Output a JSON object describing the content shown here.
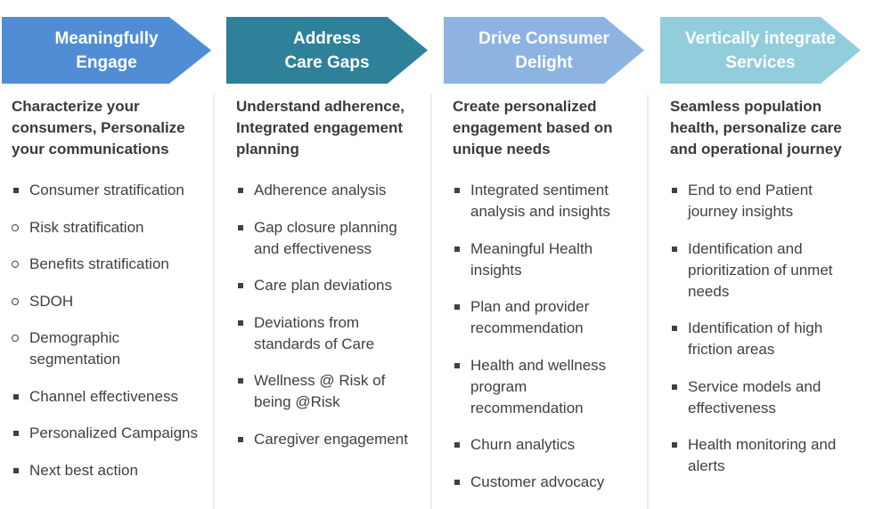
{
  "stages": [
    {
      "title_lines": [
        "Meaningfully",
        "Engage"
      ],
      "color": "#518dd4",
      "heading": "Characterize your consumers, Personalize your communications",
      "items": [
        {
          "text": "Consumer stratification",
          "bullet": "square"
        },
        {
          "text": "Risk stratification",
          "bullet": "circle"
        },
        {
          "text": "Benefits stratification",
          "bullet": "circle"
        },
        {
          "text": "SDOH",
          "bullet": "circle"
        },
        {
          "text": "Demographic segmentation",
          "bullet": "circle"
        },
        {
          "text": "Channel effectiveness",
          "bullet": "square"
        },
        {
          "text": "Personalized Campaigns",
          "bullet": "square"
        },
        {
          "text": "Next best action",
          "bullet": "square"
        }
      ]
    },
    {
      "title_lines": [
        "Address",
        "Care Gaps"
      ],
      "color": "#2f8199",
      "heading": "Understand adherence, Integrated engagement planning",
      "items": [
        {
          "text": "Adherence analysis",
          "bullet": "square"
        },
        {
          "text": "Gap closure planning and effectiveness",
          "bullet": "square"
        },
        {
          "text": "Care plan deviations",
          "bullet": "square"
        },
        {
          "text": "Deviations from standards of Care",
          "bullet": "square"
        },
        {
          "text": "Wellness @ Risk of being @Risk",
          "bullet": "square"
        },
        {
          "text": "Caregiver engagement",
          "bullet": "square"
        }
      ]
    },
    {
      "title_lines": [
        "Drive Consumer",
        "Delight"
      ],
      "color": "#8db3e2",
      "heading": "Create personalized engagement based on unique needs",
      "items": [
        {
          "text": "Integrated sentiment analysis and insights",
          "bullet": "square"
        },
        {
          "text": "Meaningful Health insights",
          "bullet": "square"
        },
        {
          "text": "Plan and provider recommendation",
          "bullet": "square"
        },
        {
          "text": "Health and wellness program recommendation",
          "bullet": "square"
        },
        {
          "text": "Churn analytics",
          "bullet": "square"
        },
        {
          "text": "Customer advocacy",
          "bullet": "square"
        }
      ]
    },
    {
      "title_lines": [
        "Vertically integrate",
        "Services"
      ],
      "color": "#92cddc",
      "heading": "Seamless population health, personalize care and operational journey",
      "items": [
        {
          "text": "End to end Patient journey insights",
          "bullet": "square"
        },
        {
          "text": "Identification and prioritization of unmet needs",
          "bullet": "square"
        },
        {
          "text": "Identification of high friction areas",
          "bullet": "square"
        },
        {
          "text": "Service models and effectiveness",
          "bullet": "square"
        },
        {
          "text": "Health monitoring and alerts",
          "bullet": "square"
        }
      ]
    }
  ]
}
